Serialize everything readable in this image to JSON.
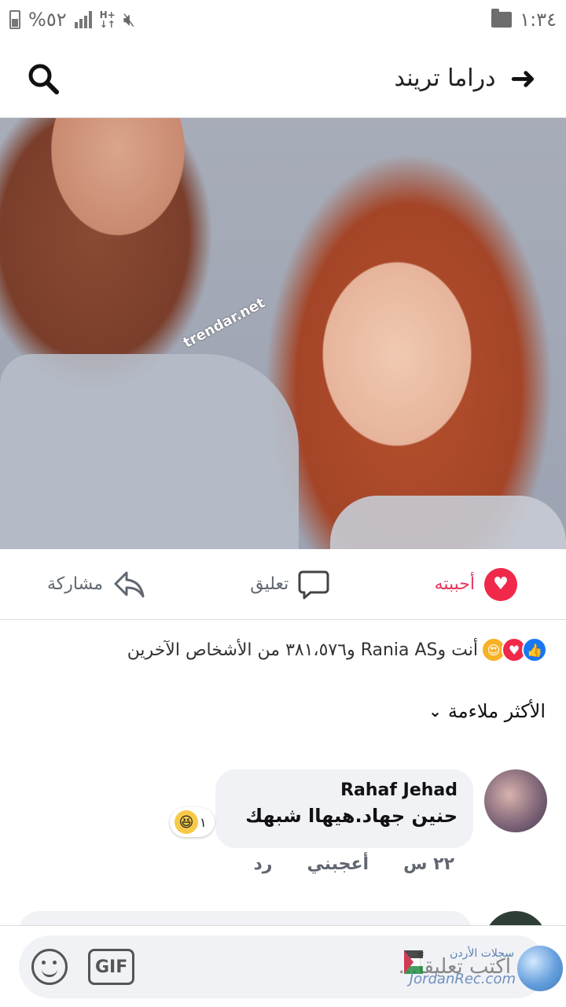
{
  "status_bar": {
    "battery": "%٥٢",
    "network": "H+",
    "time": "١:٣٤"
  },
  "header": {
    "title": "دراما تريند",
    "back_icon": "arrow-right-icon",
    "search_icon": "search-icon"
  },
  "photo": {
    "watermark": "trendar.net"
  },
  "actions": {
    "like_label": "أحببته",
    "comment_label": "تعليق",
    "share_label": "مشاركة",
    "like_color": "#e5385b"
  },
  "reactions": {
    "summary": "أنت وRania AS و٣٨١،٥٧٦ من الأشخاص الآخرين",
    "icons": [
      "like-icon",
      "love-icon",
      "care-icon"
    ]
  },
  "sort": {
    "label": "الأكثر ملاءمة"
  },
  "comments": [
    {
      "author": "Rahaf Jehad",
      "text": "حنين جهاد.هيهاا شبهك",
      "reaction_count": "١",
      "time": "٢٢ س",
      "like_label": "أعجبني",
      "reply_label": "رد"
    }
  ],
  "composer": {
    "placeholder": "اكتب تعليقاً...",
    "gif_label": "GIF"
  },
  "logo": {
    "top_text": "سجلات الأردن",
    "bottom_text": "JordanRec.com"
  }
}
